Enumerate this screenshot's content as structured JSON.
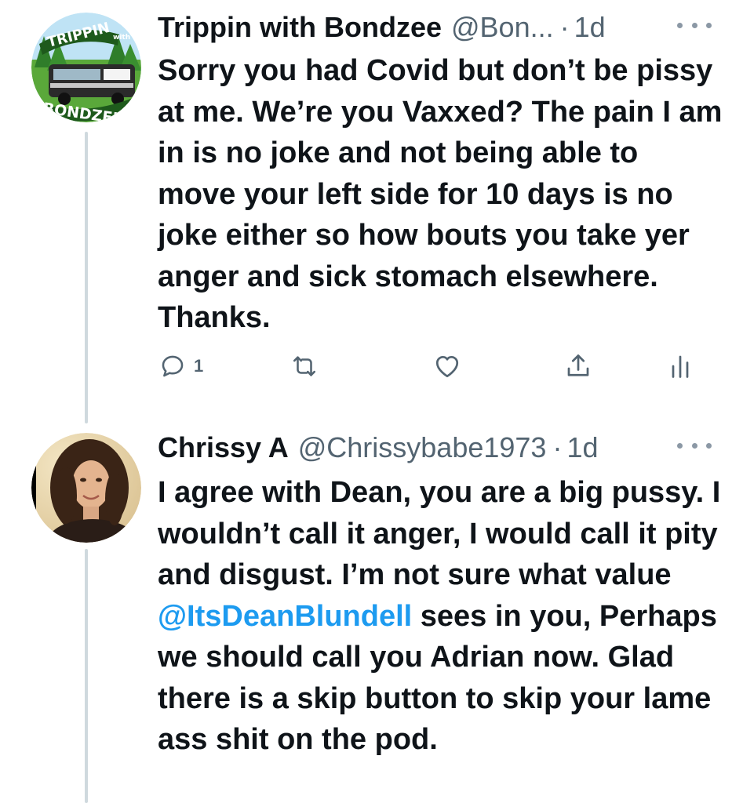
{
  "tweets": [
    {
      "avatar": {
        "kind": "logo",
        "text_top": "TRIPPIN",
        "text_small": "with",
        "text_bottom": "BONDZEE"
      },
      "author_name": "Trippin with Bondzee",
      "handle": "@Bon...",
      "dot": "·",
      "time": "1d",
      "body": "Sorry you had Covid but don’t be pissy at me. We’re you Vaxxed? The pain I am in is no joke and not being able to move your left side for 10 days is no joke either so how bouts you take yer anger and sick stomach elsewhere. Thanks.",
      "actions": {
        "reply_icon": "reply-icon",
        "reply_count": "1",
        "retweet_icon": "retweet-icon",
        "like_icon": "heart-icon",
        "share_icon": "share-icon",
        "analytics_icon": "analytics-icon"
      }
    },
    {
      "avatar": {
        "kind": "photo"
      },
      "author_name": "Chrissy A",
      "handle": "@Chrissybabe1973",
      "dot": "·",
      "time": "1d",
      "body_before_mention": "I agree with Dean, you are a big pussy. I wouldn’t call it anger, I would call it pity and disgust. I’m not sure what value ",
      "mention": "@ItsDeanBlundell",
      "body_after_mention": " sees in you, Perhaps we should call you Adrian now. Glad there is a skip button to skip your lame ass shit on the pod."
    }
  ],
  "colors": {
    "text": "#0f1419",
    "secondary": "#536471",
    "link": "#1d9bf0",
    "thread_line": "#cfd9de",
    "more_dots": "#8b98a5"
  }
}
